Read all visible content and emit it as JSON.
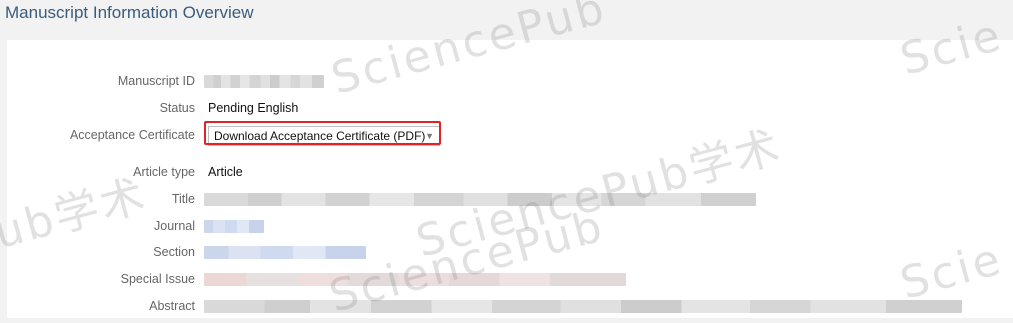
{
  "header": {
    "title": "Manuscript Information Overview"
  },
  "fields": {
    "manuscript_id": {
      "label": "Manuscript ID"
    },
    "status": {
      "label": "Status",
      "value": "Pending English"
    },
    "acceptance_certificate": {
      "label": "Acceptance Certificate",
      "selected": "Download Acceptance Certificate (PDF)",
      "arrow_icon": "chevron-down-icon"
    },
    "article_type": {
      "label": "Article type",
      "value": "Article"
    },
    "title": {
      "label": "Title"
    },
    "journal": {
      "label": "Journal"
    },
    "section": {
      "label": "Section"
    },
    "special_issue": {
      "label": "Special Issue"
    },
    "abstract": {
      "label": "Abstract"
    }
  },
  "watermarks": [
    "SciencePub",
    "Scie",
    "ub学术",
    "SciencePub学术",
    "SciencePub",
    "Scie"
  ],
  "colors": {
    "header_text": "#3b5c7c",
    "highlight": "#e02424",
    "background": "#f2f2f2"
  }
}
